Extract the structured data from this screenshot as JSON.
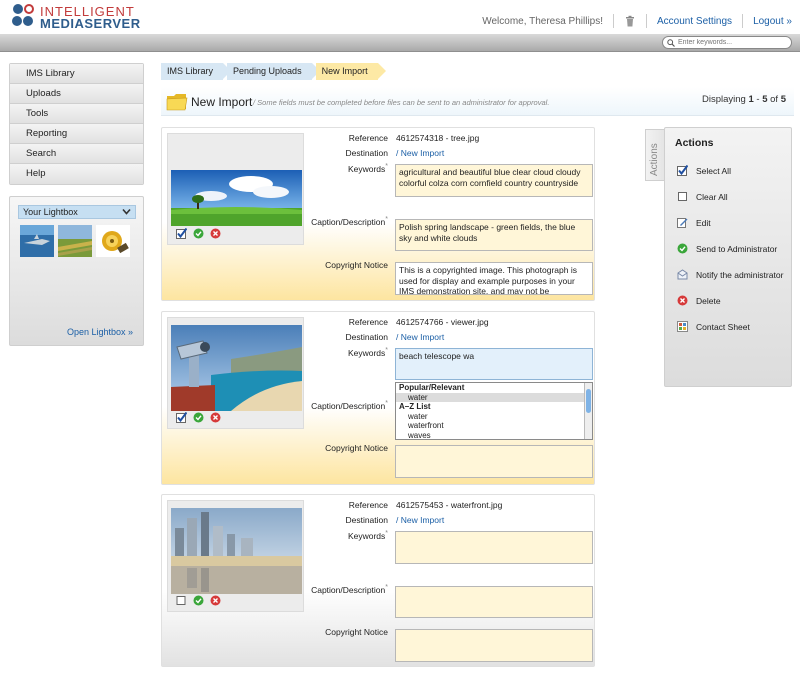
{
  "header": {
    "logo_line1": "INTELLIGENT",
    "logo_line2": "MEDIASERVER",
    "welcome": "Welcome, Theresa Phillips!",
    "account_settings": "Account Settings",
    "logout": "Logout »",
    "search_placeholder": "Enter keywords..."
  },
  "sidebar": {
    "items": [
      {
        "label": "IMS Library"
      },
      {
        "label": "Uploads"
      },
      {
        "label": "Tools"
      },
      {
        "label": "Reporting"
      },
      {
        "label": "Search"
      },
      {
        "label": "Help"
      }
    ]
  },
  "lightbox": {
    "title": "Your Lightbox",
    "open_link": "Open Lightbox »",
    "thumbnails": [
      "shark",
      "field",
      "film-reel"
    ]
  },
  "breadcrumb": [
    "IMS Library",
    "Pending Uploads",
    "New Import"
  ],
  "page": {
    "title": "New Import",
    "note": "/ Some fields must be completed before files can be sent to an administrator for approval.",
    "displaying_prefix": "Displaying ",
    "range_start": "1",
    "range_sep": " - ",
    "range_end": "5",
    "of_word": " of ",
    "total": "5"
  },
  "labels": {
    "reference": "Reference",
    "destination": "Destination",
    "keywords": "Keywords",
    "caption": "Caption/Description",
    "copyright": "Copyright Notice",
    "required_marker": "*"
  },
  "records": [
    {
      "reference": "4612574318 - tree.jpg",
      "destination": "/ New Import",
      "keywords": "agricultural and beautiful blue clear cloud cloudy colorful colza corn cornfield country countryside",
      "caption": "Polish spring landscape - green fields, the blue sky and white clouds",
      "copyright": "This is a copyrighted image. This photograph is used for display and example purposes in your IMS demonstration site, and may not be",
      "selected": true
    },
    {
      "reference": "4612574766 - viewer.jpg",
      "destination": "/ New Import",
      "keywords": "beach telescope wa",
      "caption": "",
      "copyright": "",
      "selected": true,
      "suggestions": {
        "group1": "Popular/Relevant",
        "group1_items": [
          "water"
        ],
        "group2": "A–Z List",
        "group2_items": [
          "water",
          "waterfront",
          "waves"
        ]
      }
    },
    {
      "reference": "4612575453 - waterfront.jpg",
      "destination": "/ New Import",
      "keywords": "",
      "caption": "",
      "copyright": "",
      "selected": false
    }
  ],
  "actions": {
    "tab_label": "Actions",
    "title": "Actions",
    "items": [
      {
        "label": "Select All",
        "icon": "checkmark-icon"
      },
      {
        "label": "Clear All",
        "icon": "checkbox-empty-icon"
      },
      {
        "label": "Edit",
        "icon": "edit-icon"
      },
      {
        "label": "Send to Administrator",
        "icon": "send-check-icon"
      },
      {
        "label": "Notify the administrator",
        "icon": "envelope-icon"
      },
      {
        "label": "Delete",
        "icon": "delete-icon"
      },
      {
        "label": "Contact Sheet",
        "icon": "contact-sheet-icon"
      }
    ]
  },
  "colors": {
    "link": "#1b5fa6",
    "crumb_blue": "#d7e7f4",
    "crumb_active": "#fde9a5",
    "field_bg": "#fff6d8",
    "card_fade": "#fde5a0"
  }
}
